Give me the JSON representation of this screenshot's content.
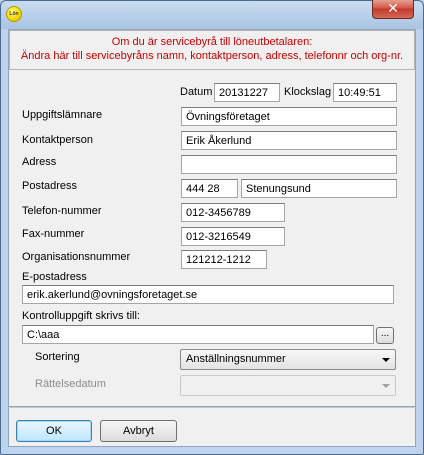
{
  "window": {
    "app_icon_text": "Lön",
    "close_glyph": "✕"
  },
  "info": {
    "line1": "Om du är servicebyrå till löneutbetalaren:",
    "line2": "Ändra här till servicebyråns namn, kontaktperson, adress, telefonnr och org-nr."
  },
  "date": {
    "label": "Datum",
    "value": "20131227"
  },
  "time": {
    "label": "Klockslag",
    "value": "10:49:51"
  },
  "form": {
    "provider": {
      "label": "Uppgiftslämnare",
      "value": "Övningsföretaget"
    },
    "contact": {
      "label": "Kontaktperson",
      "value": "Erik Åkerlund"
    },
    "address": {
      "label": "Adress",
      "value": ""
    },
    "postal": {
      "label": "Postadress",
      "zip": "444 28",
      "city": "Stenungsund"
    },
    "phone": {
      "label": "Telefon-nummer",
      "value": "012-3456789"
    },
    "fax": {
      "label": "Fax-nummer",
      "value": "012-3216549"
    },
    "orgnr": {
      "label": "Organisationsnummer",
      "value": "121212-1212"
    },
    "email": {
      "label": "E-postadress",
      "value": "erik.akerlund@ovningsforetaget.se"
    },
    "path": {
      "label": "Kontrolluppgift skrivs till:",
      "value": "C:\\aaa",
      "browse": "..."
    },
    "sort": {
      "label": "Sortering",
      "value": "Anställningsnummer"
    },
    "correction_date": {
      "label": "Rättelsedatum",
      "value": ""
    }
  },
  "buttons": {
    "ok": "OK",
    "cancel": "Avbryt"
  }
}
